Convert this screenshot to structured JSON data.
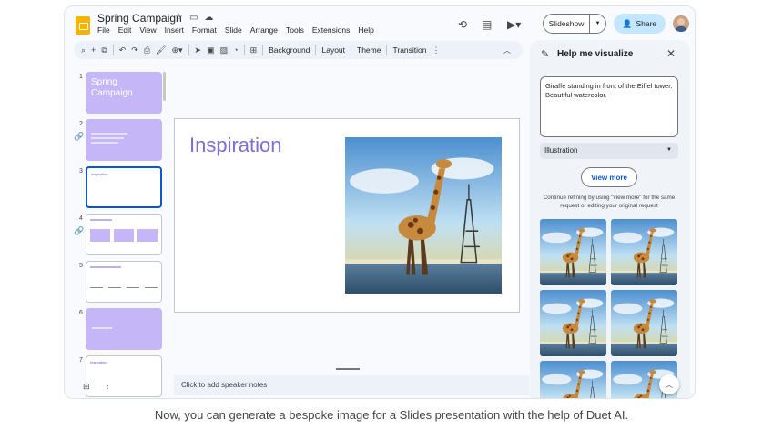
{
  "header": {
    "title": "Spring Campaign",
    "menu": [
      "File",
      "Edit",
      "View",
      "Insert",
      "Format",
      "Slide",
      "Arrange",
      "Tools",
      "Extensions",
      "Help"
    ],
    "slideshow_label": "Slideshow",
    "share_label": "Share"
  },
  "toolbar": {
    "background_label": "Background",
    "layout_label": "Layout",
    "theme_label": "Theme",
    "transition_label": "Transition"
  },
  "filmstrip": {
    "numbers": [
      "1",
      "2",
      "3",
      "4",
      "5",
      "6",
      "7"
    ],
    "thumb1_title": "Spring Campaign",
    "thumb3_title": "Inspiration",
    "thumb7_title": "Inspiration"
  },
  "slide": {
    "title": "Inspiration"
  },
  "speaker_notes": "Click to add speaker notes",
  "panel": {
    "title": "Help me visualize",
    "prompt": "Giraffe standing in front of the Eiffel tower. Beautiful watercolor.",
    "style": "Illustration",
    "view_more": "View more",
    "hint": "Continue refining by using \"view more\" for the same request or editing your original request"
  },
  "caption": "Now, you can generate a bespoke image for a Slides presentation with the help of Duet AI."
}
